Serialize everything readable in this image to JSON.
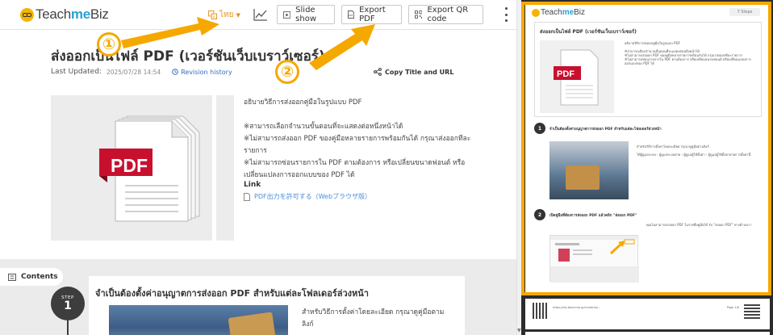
{
  "header": {
    "logo_text_a": "Teach",
    "logo_text_b": "me",
    "logo_text_c": "Biz",
    "language": "ไทย",
    "slideshow_label": "Slide show",
    "export_pdf_label": "Export PDF",
    "export_qr_label": "Export QR code"
  },
  "article": {
    "title": "ส่งออกเป็นไฟล์ PDF (เวอร์ชันเว็บเบราว์เซอร์)",
    "last_updated_label": "Last Updated:",
    "last_updated_value": "2025/07/28 14:54",
    "revision_history": "Revision history",
    "copy_title_url": "Copy Title and URL",
    "pdf_image_text": "PDF",
    "description": [
      "อธิบายวิธีการส่งออกคู่มือในรูปแบบ PDF",
      "",
      "※สามารถเลือกจำนวนขั้นตอนที่จะแสดงต่อหนึ่งหน้าได้",
      "※ไม่สามารถส่งออก PDF ของคู่มือหลายรายการพร้อมกันได้ กรุณาส่งออกทีละรายการ",
      "※ไม่สามารถซ่อนรายการใน PDF ตามต้องการ หรือเปลี่ยนขนาดฟอนต์ หรือเปลี่ยนแปลงการออกแบบของ PDF ได้"
    ],
    "link_heading": "Link",
    "link_text": "PDF出力を許可する（Webブラウザ版）",
    "contents_label": "Contents",
    "step": {
      "label": "STEP",
      "number": "1",
      "title": "จำเป็นต้องตั้งค่าอนุญาตการส่งออก PDF สำหรับแต่ละโฟลเดอร์ล่วงหน้า",
      "description": "สำหรับวิธีการตั้งค่าโดยละเอียด กรุณาดูคู่มือตามลิงก์"
    }
  },
  "preview": {
    "logo_text_a": "Teach",
    "logo_text_b": "me",
    "logo_text_c": "Biz",
    "badge": "7 Steps",
    "title": "ส่งออกเป็นไฟล์ PDF (เวอร์ชันเว็บเบราว์เซอร์)",
    "summary": [
      "อธิบายวิธีการส่งออกคู่มือในรูปแบบ PDF",
      "※สามารถเลือกจำนวนขั้นตอนที่จะแสดงต่อหนึ่งหน้าได้",
      "※ไม่สามารถส่งออก PDF ของคู่มือหลายรายการพร้อมกันได้ กรุณาส่งออกทีละรายการ",
      "※ไม่สามารถซ่อนรายการใน PDF ตามต้องการ หรือเปลี่ยนขนาดฟอนต์ หรือเปลี่ยนแปลงการออกแบบของ PDF ได้"
    ],
    "step1_number": "1",
    "step1_title": "จำเป็นต้องตั้งค่าอนุญาตการส่งออก PDF สำหรับแต่ละโฟลเดอร์ล่วงหน้า",
    "step1_desc_a": "สำหรับวิธีการตั้งค่าโดยละเอียด กรุณาดูคู่มือตามลิงก์",
    "step1_desc_b": "ให้ผู้ดูแลระบบ・ผู้ดูแลระบบฝ่าย・ผู้ดูแลผู้ใช้ตั้งค่า・ผู้ดูแลผู้ใช้ตั้งค่าฝ่ายการตั้งค่านี้",
    "step2_number": "2",
    "step2_title": "เปิดคู่มือที่ต้องการส่งออก PDF แล้วคลิก \"ส่งออก PDF\"",
    "step2_desc": "คุณไม่สามารถส่งออก PDF ในรายชื่อคู่มือได้ รับ \"ส่งออก PDF\" ทางด้านขวา",
    "footer_url": "https://biz.teachme.jp/contents/...",
    "footer_right": "Page 1/6"
  },
  "annotations": {
    "one": "①",
    "two": "②"
  },
  "colors": {
    "accent_orange": "#f5a800",
    "brand_blue": "#2aa0d8",
    "link_blue": "#4a8fd8",
    "step_dark": "#3d3d3d",
    "pdf_red": "#c8102e"
  }
}
